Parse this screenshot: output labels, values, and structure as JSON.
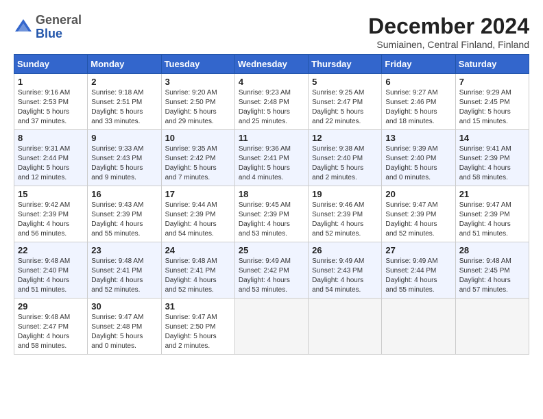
{
  "header": {
    "logo_general": "General",
    "logo_blue": "Blue",
    "month_title": "December 2024",
    "subtitle": "Sumiainen, Central Finland, Finland"
  },
  "weekdays": [
    "Sunday",
    "Monday",
    "Tuesday",
    "Wednesday",
    "Thursday",
    "Friday",
    "Saturday"
  ],
  "weeks": [
    [
      {
        "day": "1",
        "info": "Sunrise: 9:16 AM\nSunset: 2:53 PM\nDaylight: 5 hours\nand 37 minutes."
      },
      {
        "day": "2",
        "info": "Sunrise: 9:18 AM\nSunset: 2:51 PM\nDaylight: 5 hours\nand 33 minutes."
      },
      {
        "day": "3",
        "info": "Sunrise: 9:20 AM\nSunset: 2:50 PM\nDaylight: 5 hours\nand 29 minutes."
      },
      {
        "day": "4",
        "info": "Sunrise: 9:23 AM\nSunset: 2:48 PM\nDaylight: 5 hours\nand 25 minutes."
      },
      {
        "day": "5",
        "info": "Sunrise: 9:25 AM\nSunset: 2:47 PM\nDaylight: 5 hours\nand 22 minutes."
      },
      {
        "day": "6",
        "info": "Sunrise: 9:27 AM\nSunset: 2:46 PM\nDaylight: 5 hours\nand 18 minutes."
      },
      {
        "day": "7",
        "info": "Sunrise: 9:29 AM\nSunset: 2:45 PM\nDaylight: 5 hours\nand 15 minutes."
      }
    ],
    [
      {
        "day": "8",
        "info": "Sunrise: 9:31 AM\nSunset: 2:44 PM\nDaylight: 5 hours\nand 12 minutes."
      },
      {
        "day": "9",
        "info": "Sunrise: 9:33 AM\nSunset: 2:43 PM\nDaylight: 5 hours\nand 9 minutes."
      },
      {
        "day": "10",
        "info": "Sunrise: 9:35 AM\nSunset: 2:42 PM\nDaylight: 5 hours\nand 7 minutes."
      },
      {
        "day": "11",
        "info": "Sunrise: 9:36 AM\nSunset: 2:41 PM\nDaylight: 5 hours\nand 4 minutes."
      },
      {
        "day": "12",
        "info": "Sunrise: 9:38 AM\nSunset: 2:40 PM\nDaylight: 5 hours\nand 2 minutes."
      },
      {
        "day": "13",
        "info": "Sunrise: 9:39 AM\nSunset: 2:40 PM\nDaylight: 5 hours\nand 0 minutes."
      },
      {
        "day": "14",
        "info": "Sunrise: 9:41 AM\nSunset: 2:39 PM\nDaylight: 4 hours\nand 58 minutes."
      }
    ],
    [
      {
        "day": "15",
        "info": "Sunrise: 9:42 AM\nSunset: 2:39 PM\nDaylight: 4 hours\nand 56 minutes."
      },
      {
        "day": "16",
        "info": "Sunrise: 9:43 AM\nSunset: 2:39 PM\nDaylight: 4 hours\nand 55 minutes."
      },
      {
        "day": "17",
        "info": "Sunrise: 9:44 AM\nSunset: 2:39 PM\nDaylight: 4 hours\nand 54 minutes."
      },
      {
        "day": "18",
        "info": "Sunrise: 9:45 AM\nSunset: 2:39 PM\nDaylight: 4 hours\nand 53 minutes."
      },
      {
        "day": "19",
        "info": "Sunrise: 9:46 AM\nSunset: 2:39 PM\nDaylight: 4 hours\nand 52 minutes."
      },
      {
        "day": "20",
        "info": "Sunrise: 9:47 AM\nSunset: 2:39 PM\nDaylight: 4 hours\nand 52 minutes."
      },
      {
        "day": "21",
        "info": "Sunrise: 9:47 AM\nSunset: 2:39 PM\nDaylight: 4 hours\nand 51 minutes."
      }
    ],
    [
      {
        "day": "22",
        "info": "Sunrise: 9:48 AM\nSunset: 2:40 PM\nDaylight: 4 hours\nand 51 minutes."
      },
      {
        "day": "23",
        "info": "Sunrise: 9:48 AM\nSunset: 2:41 PM\nDaylight: 4 hours\nand 52 minutes."
      },
      {
        "day": "24",
        "info": "Sunrise: 9:48 AM\nSunset: 2:41 PM\nDaylight: 4 hours\nand 52 minutes."
      },
      {
        "day": "25",
        "info": "Sunrise: 9:49 AM\nSunset: 2:42 PM\nDaylight: 4 hours\nand 53 minutes."
      },
      {
        "day": "26",
        "info": "Sunrise: 9:49 AM\nSunset: 2:43 PM\nDaylight: 4 hours\nand 54 minutes."
      },
      {
        "day": "27",
        "info": "Sunrise: 9:49 AM\nSunset: 2:44 PM\nDaylight: 4 hours\nand 55 minutes."
      },
      {
        "day": "28",
        "info": "Sunrise: 9:48 AM\nSunset: 2:45 PM\nDaylight: 4 hours\nand 57 minutes."
      }
    ],
    [
      {
        "day": "29",
        "info": "Sunrise: 9:48 AM\nSunset: 2:47 PM\nDaylight: 4 hours\nand 58 minutes."
      },
      {
        "day": "30",
        "info": "Sunrise: 9:47 AM\nSunset: 2:48 PM\nDaylight: 5 hours\nand 0 minutes."
      },
      {
        "day": "31",
        "info": "Sunrise: 9:47 AM\nSunset: 2:50 PM\nDaylight: 5 hours\nand 2 minutes."
      },
      {
        "day": "",
        "info": ""
      },
      {
        "day": "",
        "info": ""
      },
      {
        "day": "",
        "info": ""
      },
      {
        "day": "",
        "info": ""
      }
    ]
  ]
}
